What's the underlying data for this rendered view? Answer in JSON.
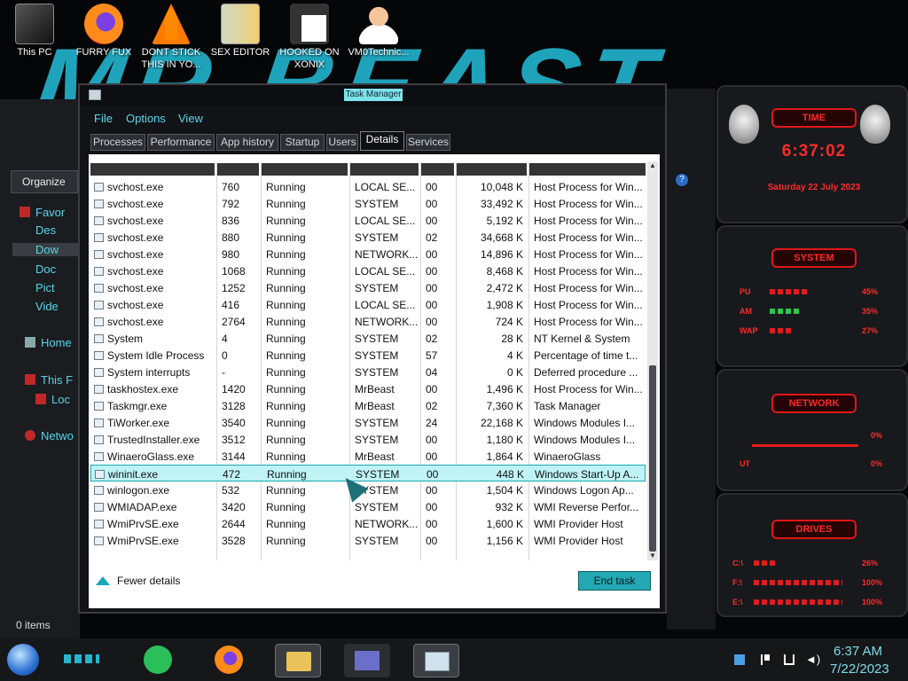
{
  "desktop": {
    "icons": [
      {
        "label": "This PC",
        "icon": "pc-icon"
      },
      {
        "label": "FURRY FUX",
        "icon": "firefox-icon"
      },
      {
        "label": "DONT STICK THIS IN YO...",
        "icon": "vlc-icon"
      },
      {
        "label": "SEX EDITOR",
        "icon": "hxd-icon"
      },
      {
        "label": "HOOKED ON XONIX",
        "icon": "xonix-icon"
      },
      {
        "label": "VM0Technic...",
        "icon": "doctor-icon"
      }
    ]
  },
  "explorer": {
    "organize": "Organize",
    "items": [
      "Favor",
      "Des",
      "Dow",
      "Doc",
      "Pict",
      "Vide",
      "Home",
      "This F",
      "Loc",
      "Netwo"
    ],
    "status": "0 items"
  },
  "taskmanager": {
    "title": "Task Manager",
    "menu": [
      "File",
      "Options",
      "View"
    ],
    "tabs": [
      "Processes",
      "Performance",
      "App history",
      "Startup",
      "Users",
      "Details",
      "Services"
    ],
    "active_tab": "Details",
    "rows": [
      [
        "svchost.exe",
        "760",
        "Running",
        "LOCAL SE...",
        "00",
        "10,048 K",
        "Host Process for Win..."
      ],
      [
        "svchost.exe",
        "792",
        "Running",
        "SYSTEM",
        "00",
        "33,492 K",
        "Host Process for Win..."
      ],
      [
        "svchost.exe",
        "836",
        "Running",
        "LOCAL SE...",
        "00",
        "5,192 K",
        "Host Process for Win..."
      ],
      [
        "svchost.exe",
        "880",
        "Running",
        "SYSTEM",
        "02",
        "34,668 K",
        "Host Process for Win..."
      ],
      [
        "svchost.exe",
        "980",
        "Running",
        "NETWORK...",
        "00",
        "14,896 K",
        "Host Process for Win..."
      ],
      [
        "svchost.exe",
        "1068",
        "Running",
        "LOCAL SE...",
        "00",
        "8,468 K",
        "Host Process for Win..."
      ],
      [
        "svchost.exe",
        "1252",
        "Running",
        "SYSTEM",
        "00",
        "2,472 K",
        "Host Process for Win..."
      ],
      [
        "svchost.exe",
        "416",
        "Running",
        "LOCAL SE...",
        "00",
        "1,908 K",
        "Host Process for Win..."
      ],
      [
        "svchost.exe",
        "2764",
        "Running",
        "NETWORK...",
        "00",
        "724 K",
        "Host Process for Win..."
      ],
      [
        "System",
        "4",
        "Running",
        "SYSTEM",
        "02",
        "28 K",
        "NT Kernel & System"
      ],
      [
        "System Idle Process",
        "0",
        "Running",
        "SYSTEM",
        "57",
        "4 K",
        "Percentage of time t..."
      ],
      [
        "System interrupts",
        "-",
        "Running",
        "SYSTEM",
        "04",
        "0 K",
        "Deferred procedure ..."
      ],
      [
        "taskhostex.exe",
        "1420",
        "Running",
        "MrBeast",
        "00",
        "1,496 K",
        "Host Process for Win..."
      ],
      [
        "Taskmgr.exe",
        "3128",
        "Running",
        "MrBeast",
        "02",
        "7,360 K",
        "Task Manager"
      ],
      [
        "TiWorker.exe",
        "3540",
        "Running",
        "SYSTEM",
        "24",
        "22,168 K",
        "Windows Modules I..."
      ],
      [
        "TrustedInstaller.exe",
        "3512",
        "Running",
        "SYSTEM",
        "00",
        "1,180 K",
        "Windows Modules I..."
      ],
      [
        "WinaeroGlass.exe",
        "3144",
        "Running",
        "MrBeast",
        "00",
        "1,864 K",
        "WinaeroGlass"
      ],
      [
        "wininit.exe",
        "472",
        "Running",
        "SYSTEM",
        "00",
        "448 K",
        "Windows Start-Up A..."
      ],
      [
        "winlogon.exe",
        "532",
        "Running",
        "SYSTEM",
        "00",
        "1,504 K",
        "Windows Logon Ap..."
      ],
      [
        "WMIADAP.exe",
        "3420",
        "Running",
        "SYSTEM",
        "00",
        "932 K",
        "WMI Reverse Perfor..."
      ],
      [
        "WmiPrvSE.exe",
        "2644",
        "Running",
        "NETWORK...",
        "00",
        "1,600 K",
        "WMI Provider Host"
      ],
      [
        "WmiPrvSE.exe",
        "3528",
        "Running",
        "SYSTEM",
        "00",
        "1,156 K",
        "WMI Provider Host"
      ]
    ],
    "selected_row": 17,
    "fewer_details": "Fewer details",
    "end_task": "End task"
  },
  "gadgets": {
    "time_header": "TIME",
    "time": "6:37:02",
    "date": "Saturday 22 July 2023",
    "system_header": "SYSTEM",
    "cpu_label": "PU",
    "cpu_value": "45%",
    "cpu_level": 0.45,
    "ram_label": "AM",
    "ram_value": "35%",
    "ram_level": 0.35,
    "swap_label": "WAP",
    "swap_value": "27%",
    "swap_level": 0.27,
    "network_header": "NETWORK",
    "net_in": "0%",
    "net_out_label": "UT",
    "net_out": "0%",
    "drives_header": "DRIVES",
    "drives": [
      {
        "label": "C:\\",
        "value": "26%",
        "level": 0.26
      },
      {
        "label": "F:\\",
        "value": "100%",
        "level": 1.0
      },
      {
        "label": "E:\\",
        "value": "100%",
        "level": 1.0
      }
    ]
  },
  "wallpaper": {
    "text": "MR BEAST"
  },
  "taskbar": {
    "time": "6:37 AM",
    "date": "7/22/2023"
  },
  "colors": {
    "accent": "#22b5cf",
    "gadget_red": "#ff2a2a",
    "selection": "#bff3f5"
  }
}
